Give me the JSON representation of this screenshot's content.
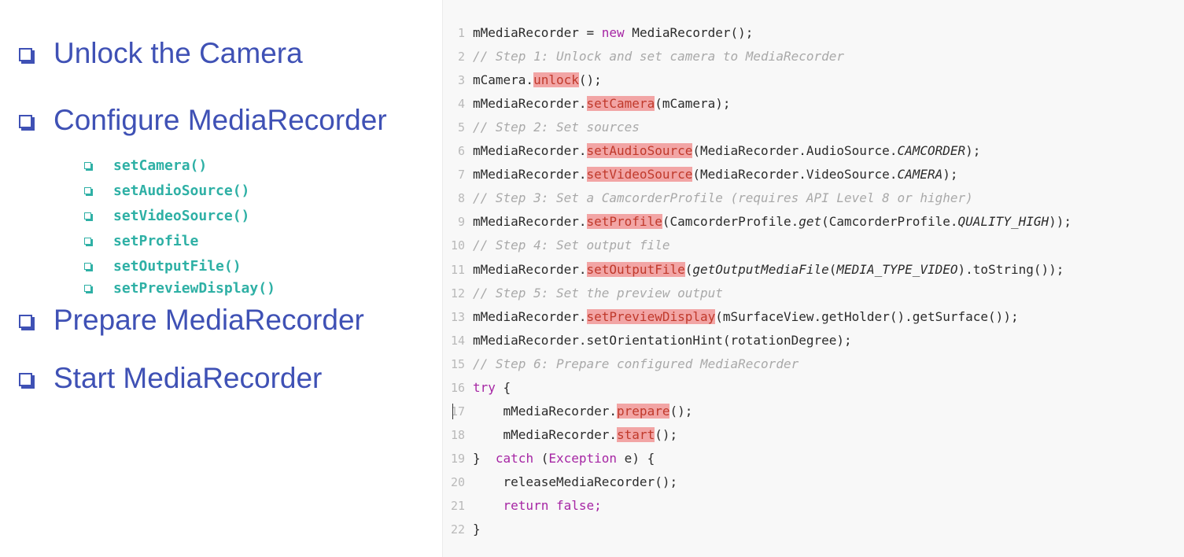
{
  "checklist": {
    "items": [
      {
        "label": "Unlock the Camera"
      },
      {
        "label": "Configure MediaRecorder"
      },
      {
        "label": "Prepare MediaRecorder"
      },
      {
        "label": "Start MediaRecorder"
      }
    ],
    "sub_items": [
      {
        "label": "setCamera()"
      },
      {
        "label": "setAudioSource()"
      },
      {
        "label": "setVideoSource()"
      },
      {
        "label": "setProfile"
      },
      {
        "label": "setOutputFile()"
      },
      {
        "label": "setPreviewDisplay()"
      }
    ]
  },
  "code": {
    "lines": [
      {
        "num": "1",
        "parts": [
          {
            "t": "mMediaRecorder = "
          },
          {
            "t": "new",
            "c": "kw"
          },
          {
            "t": " MediaRecorder();"
          }
        ]
      },
      {
        "num": "2",
        "parts": [
          {
            "t": "// Step 1: Unlock and set camera to MediaRecorder",
            "c": "cmt"
          }
        ]
      },
      {
        "num": "3",
        "parts": [
          {
            "t": "mCamera."
          },
          {
            "t": "unlock",
            "c": "hl"
          },
          {
            "t": "();"
          }
        ]
      },
      {
        "num": "4",
        "parts": [
          {
            "t": "mMediaRecorder."
          },
          {
            "t": "setCamera",
            "c": "hl"
          },
          {
            "t": "(mCamera);"
          }
        ]
      },
      {
        "num": "5",
        "parts": [
          {
            "t": "// Step 2: Set sources",
            "c": "cmt"
          }
        ]
      },
      {
        "num": "6",
        "parts": [
          {
            "t": "mMediaRecorder."
          },
          {
            "t": "setAudioSource",
            "c": "hl"
          },
          {
            "t": "(MediaRecorder.AudioSource."
          },
          {
            "t": "CAMCORDER",
            "c": "it"
          },
          {
            "t": ");"
          }
        ]
      },
      {
        "num": "7",
        "parts": [
          {
            "t": "mMediaRecorder."
          },
          {
            "t": "setVideoSource",
            "c": "hl"
          },
          {
            "t": "(MediaRecorder.VideoSource."
          },
          {
            "t": "CAMERA",
            "c": "it"
          },
          {
            "t": ");"
          }
        ]
      },
      {
        "num": "8",
        "parts": [
          {
            "t": "// Step 3: Set a CamcorderProfile (requires API Level 8 or higher)",
            "c": "cmt"
          }
        ]
      },
      {
        "num": "9",
        "parts": [
          {
            "t": "mMediaRecorder."
          },
          {
            "t": "setProfile",
            "c": "hl"
          },
          {
            "t": "(CamcorderProfile."
          },
          {
            "t": "get",
            "c": "it"
          },
          {
            "t": "(CamcorderProfile."
          },
          {
            "t": "QUALITY_HIGH",
            "c": "it"
          },
          {
            "t": "));"
          }
        ]
      },
      {
        "num": "10",
        "parts": [
          {
            "t": "// Step 4: Set output file",
            "c": "cmt"
          }
        ]
      },
      {
        "num": "11",
        "parts": [
          {
            "t": "mMediaRecorder."
          },
          {
            "t": "setOutputFile",
            "c": "hl"
          },
          {
            "t": "("
          },
          {
            "t": "getOutputMediaFile",
            "c": "it"
          },
          {
            "t": "("
          },
          {
            "t": "MEDIA_TYPE_VIDEO",
            "c": "it"
          },
          {
            "t": ").toString());"
          }
        ]
      },
      {
        "num": "12",
        "parts": [
          {
            "t": "// Step 5: Set the preview output",
            "c": "cmt"
          }
        ]
      },
      {
        "num": "13",
        "parts": [
          {
            "t": "mMediaRecorder."
          },
          {
            "t": "setPreviewDisplay",
            "c": "hl"
          },
          {
            "t": "(mSurfaceView.getHolder().getSurface());"
          }
        ]
      },
      {
        "num": "14",
        "parts": [
          {
            "t": "mMediaRecorder.setOrientationHint(rotationDegree);"
          }
        ]
      },
      {
        "num": "15",
        "parts": [
          {
            "t": "// Step 6: Prepare configured MediaRecorder",
            "c": "cmt"
          }
        ]
      },
      {
        "num": "16",
        "parts": [
          {
            "t": "try",
            "c": "kw"
          },
          {
            "t": " {"
          }
        ]
      },
      {
        "num": "17",
        "caret": true,
        "parts": [
          {
            "t": "    mMediaRecorder."
          },
          {
            "t": "prepare",
            "c": "hl"
          },
          {
            "t": "();"
          }
        ]
      },
      {
        "num": "18",
        "parts": [
          {
            "t": "    mMediaRecorder."
          },
          {
            "t": "start",
            "c": "hl"
          },
          {
            "t": "();"
          }
        ]
      },
      {
        "num": "19",
        "parts": [
          {
            "t": "}  "
          },
          {
            "t": "catch",
            "c": "kw"
          },
          {
            "t": " ("
          },
          {
            "t": "Exception",
            "c": "kw"
          },
          {
            "t": " e) {"
          }
        ]
      },
      {
        "num": "20",
        "parts": [
          {
            "t": "    releaseMediaRecorder();"
          }
        ]
      },
      {
        "num": "21",
        "parts": [
          {
            "t": "    "
          },
          {
            "t": "return false;",
            "c": "kw"
          }
        ]
      },
      {
        "num": "22",
        "parts": [
          {
            "t": "}"
          }
        ]
      }
    ]
  }
}
